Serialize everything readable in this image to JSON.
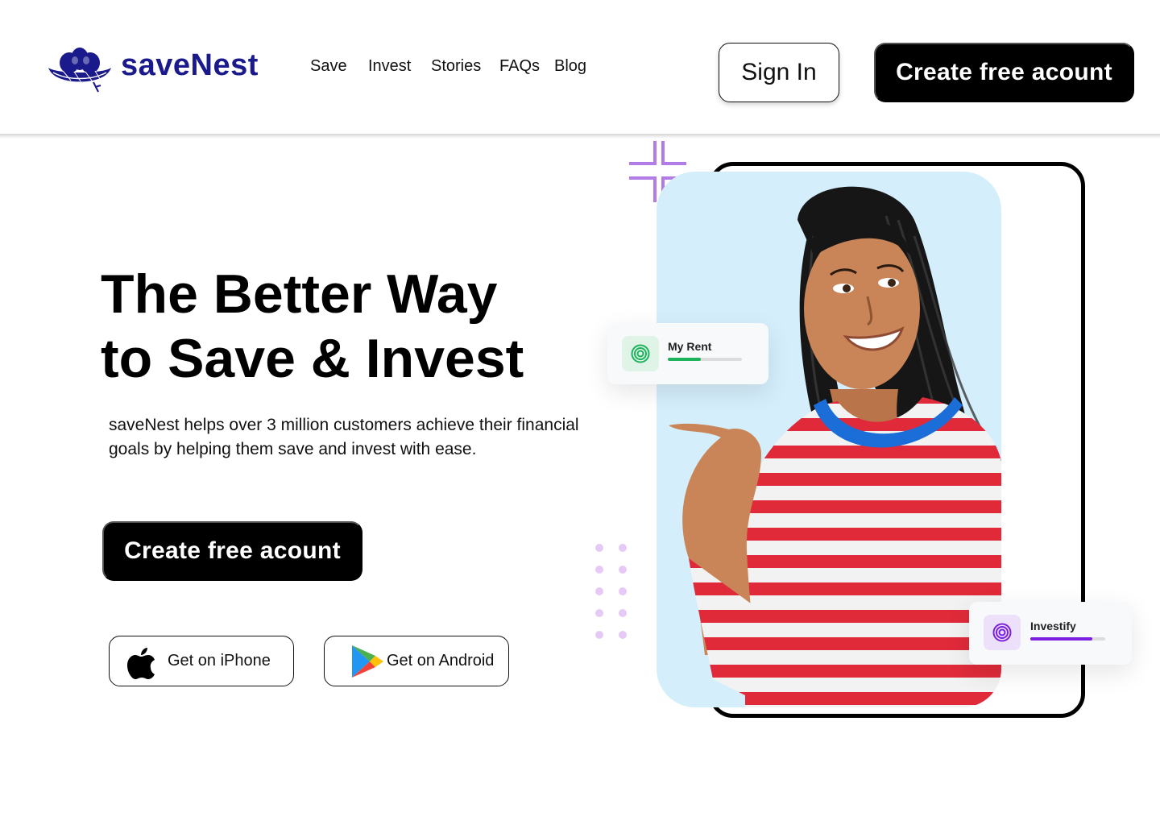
{
  "brand": {
    "name": "saveNest",
    "logo_icon": "nest-logo-icon",
    "color": "#1a1a8c"
  },
  "nav": {
    "links": [
      "Save",
      "Invest",
      "Stories",
      "FAQs",
      "Blog"
    ]
  },
  "header": {
    "sign_in_label": "Sign In",
    "create_account_label": "Create free acount"
  },
  "hero": {
    "title_line1": "The Better Way",
    "title_line2": "to Save & Invest",
    "description": "saveNest helps over 3 million customers achieve their financial goals by helping them save and invest with ease.",
    "cta_label": "Create free acount",
    "iphone_label": "Get on iPhone",
    "iphone_icon": "apple-icon",
    "android_label": "Get on Android",
    "android_icon": "google-play-icon"
  },
  "cards": {
    "rent": {
      "title": "My Rent",
      "icon": "target-icon",
      "progress": 0.45,
      "color": "#1db35c"
    },
    "investify": {
      "title": "Investify",
      "icon": "target-icon",
      "progress": 0.83,
      "color": "#7b1fe0"
    }
  },
  "colors": {
    "primary": "#000000",
    "accent_purple": "#b37be6",
    "panel_blue": "#d4eefb"
  }
}
